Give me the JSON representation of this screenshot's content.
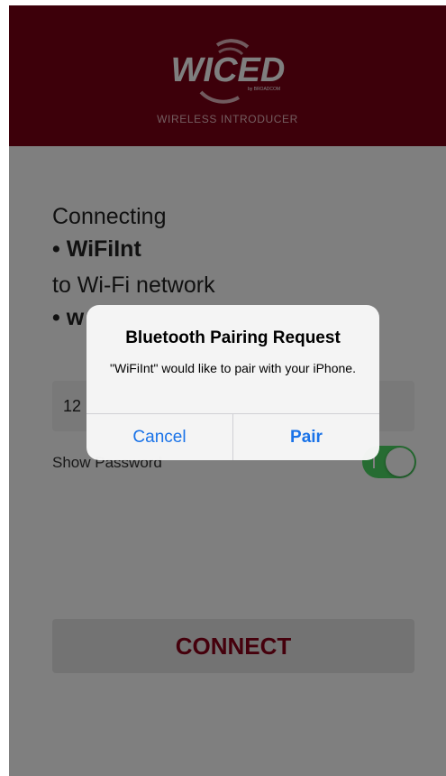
{
  "header": {
    "logo_text": "WICED",
    "logo_sub": "by BROADCOM",
    "subtitle": "WIRELESS INTRODUCER",
    "background_color": "#7a0014"
  },
  "connection": {
    "line1": "Connecting",
    "device": "• WiFiInt",
    "line3": "to Wi-Fi network",
    "network_partial": "• w"
  },
  "password_field": {
    "value_partial": "12"
  },
  "show_password": {
    "label": "Show Password",
    "toggle_on": true
  },
  "connect_button": {
    "label": "CONNECT"
  },
  "alert": {
    "title": "Bluetooth Pairing Request",
    "message": "\"WiFiInt\" would like to pair with your iPhone.",
    "cancel_label": "Cancel",
    "pair_label": "Pair",
    "button_color": "#1a73e8"
  }
}
